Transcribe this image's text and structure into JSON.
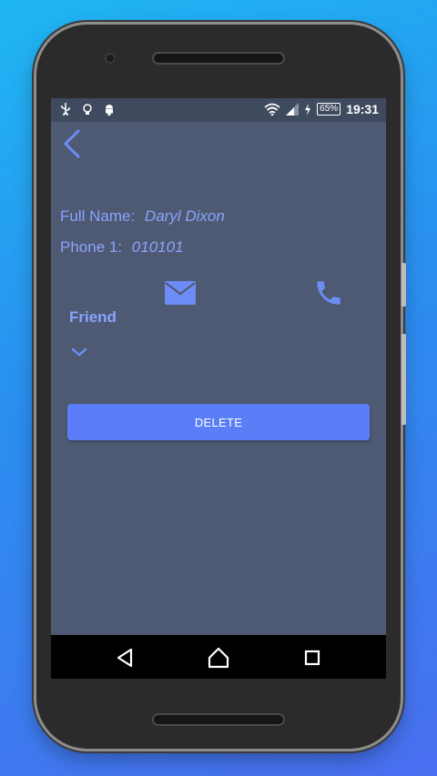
{
  "status_bar": {
    "battery": "65%",
    "time": "19:31",
    "icons": [
      "usb-icon",
      "lightbulb-icon",
      "android-icon",
      "wifi-icon",
      "signal-icon",
      "charging-icon"
    ]
  },
  "contact": {
    "full_name_label": "Full Name:",
    "full_name_value": "Daryl Dixon",
    "phone_label": "Phone 1:",
    "phone_value": "010101",
    "category": "Friend"
  },
  "actions": {
    "delete_label": "DELETE"
  },
  "colors": {
    "accent": "#8ba3ff",
    "button": "#5b7ef8",
    "screen_bg": "#4e5a73",
    "status_bar_bg": "#3f4a5f"
  }
}
